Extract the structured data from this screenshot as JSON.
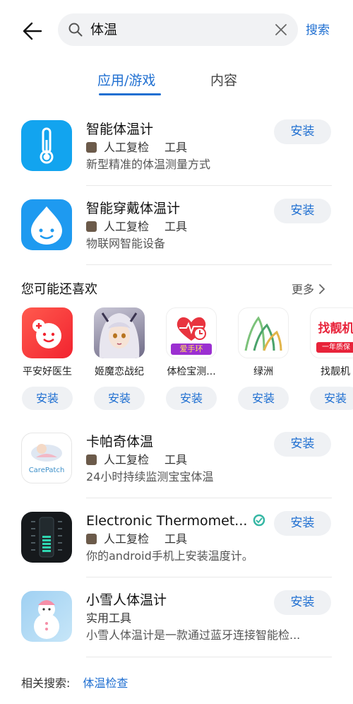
{
  "header": {
    "query": "体温",
    "search_label": "搜索"
  },
  "tabs": [
    {
      "label": "应用/游戏",
      "active": true
    },
    {
      "label": "内容",
      "active": false
    }
  ],
  "apps_top": [
    {
      "title": "智能体温计",
      "developer": "人工复检",
      "category": "工具",
      "description": "新型精准的体温测量方式",
      "install": "安装",
      "icon": "thermometer-icon"
    },
    {
      "title": "智能穿戴体温计",
      "developer": "人工复检",
      "category": "工具",
      "description": "物联网智能设备",
      "install": "安装",
      "icon": "water-drop-face-icon"
    }
  ],
  "recommend": {
    "title": "您可能还喜欢",
    "more": "更多",
    "items": [
      {
        "name": "平安好医生",
        "install": "安装",
        "icon": "chat-smile-icon"
      },
      {
        "name": "姬魔恋战纪",
        "install": "安装",
        "icon": "anime-girl-icon"
      },
      {
        "name": "体检宝测...",
        "install": "安装",
        "icon": "heart-rate-icon",
        "badge": "爱手环"
      },
      {
        "name": "绿洲",
        "install": "安装",
        "icon": "oasis-icon"
      },
      {
        "name": "找靓机",
        "install": "安装",
        "icon": "phone-shop-icon",
        "badge_title": "找靓机",
        "badge_sub": "一年质保"
      }
    ]
  },
  "apps_bottom": [
    {
      "title": "卡帕奇体温",
      "developer": "人工复检",
      "category": "工具",
      "description": "24小时持续监测宝宝体温",
      "install": "安装",
      "icon": "carepatch-icon",
      "logo_text": "CarePatch"
    },
    {
      "title": "Electronic Thermomet...",
      "developer": "人工复检",
      "category": "工具",
      "description": "你的android手机上安装温度计。",
      "install": "安装",
      "icon": "digital-thermometer-icon",
      "verified": true
    },
    {
      "title": "小雪人体温计",
      "category_only": "实用工具",
      "description": "小雪人体温计是一款通过蓝牙连接智能检...",
      "install": "安装",
      "icon": "snowman-icon"
    }
  ],
  "related": {
    "label": "相关搜索:",
    "keyword": "体温检查"
  },
  "colors": {
    "accent": "#1f6fd1",
    "button_bg": "#eff1f4",
    "divider": "#e8e8e8"
  }
}
